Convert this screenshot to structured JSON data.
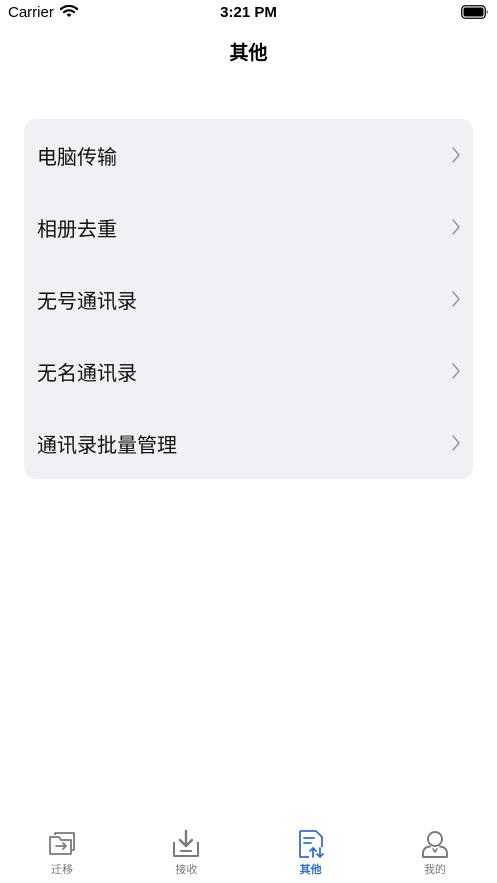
{
  "status_bar": {
    "carrier": "Carrier",
    "time": "3:21 PM"
  },
  "nav": {
    "title": "其他"
  },
  "menu": {
    "items": [
      {
        "label": "电脑传输"
      },
      {
        "label": "相册去重"
      },
      {
        "label": "无号通讯录"
      },
      {
        "label": "无名通讯录"
      },
      {
        "label": "通讯录批量管理"
      }
    ]
  },
  "tab_bar": {
    "tabs": [
      {
        "label": "迁移",
        "icon": "transfer-icon"
      },
      {
        "label": "接收",
        "icon": "download-tray-icon"
      },
      {
        "label": "其他",
        "icon": "other-document-icon",
        "active": true
      },
      {
        "label": "我的",
        "icon": "person-icon"
      }
    ]
  },
  "colors": {
    "accent": "#2f6fd6",
    "card_background": "#f0f0f5",
    "inactive_tab": "#7a7a7a"
  }
}
